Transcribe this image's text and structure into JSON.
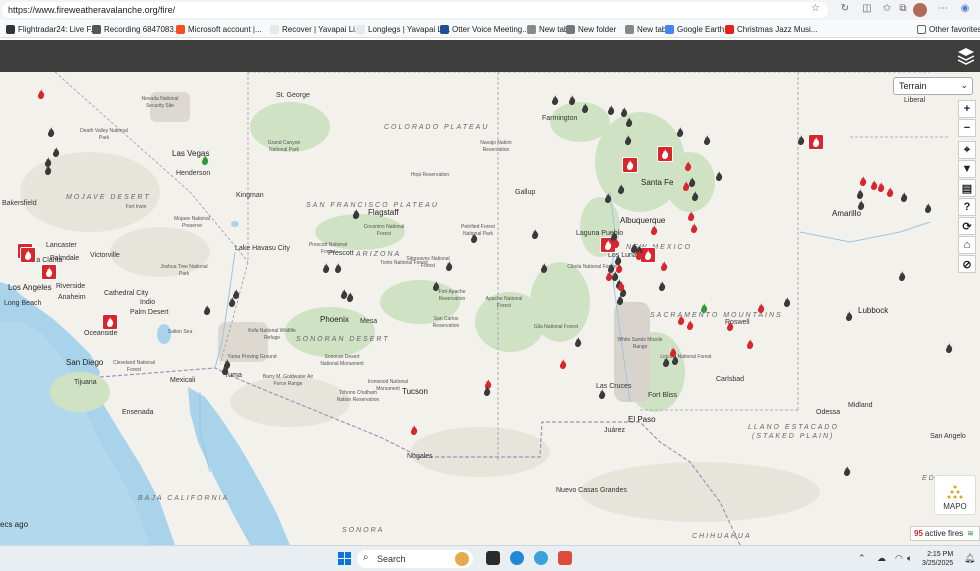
{
  "browser": {
    "url": "https://www.fireweatheravalanche.org/fire/",
    "bookmarks": [
      {
        "label": "Flightradar24: Live F...",
        "color": "#333333"
      },
      {
        "label": "Recording 6847083...",
        "color": "#555555"
      },
      {
        "label": "Microsoft account |...",
        "color": "#f25022"
      },
      {
        "label": "Recover | Yavapai Li...",
        "color": "#e8e8e8"
      },
      {
        "label": "Longlegs | Yavapai Li...",
        "color": "#e8e8e8"
      },
      {
        "label": "Otter Voice Meeting...",
        "color": "#1f4e9a"
      },
      {
        "label": "New tab",
        "color": "#888888"
      },
      {
        "label": "New folder",
        "color": "#777777"
      },
      {
        "label": "New tab",
        "color": "#888888"
      },
      {
        "label": "Google Earth",
        "color": "#4285f4"
      },
      {
        "label": "Christmas Jazz Musi...",
        "color": "#e62117"
      }
    ],
    "other_favorites": "Other favorites"
  },
  "map": {
    "basemap_select": "Terrain",
    "tools": [
      "+",
      "−",
      "⌖",
      "▼",
      "▤",
      "?",
      "⟳",
      "⌂",
      "⊘"
    ],
    "labels": {
      "cities": [
        "Las Vegas",
        "Henderson",
        "Bakersfield",
        "Lancaster",
        "Palmdale",
        "Victorville",
        "Santa Clarita",
        "Los Angeles",
        "Long Beach",
        "Anaheim",
        "Riverside",
        "Oceanside",
        "San Diego",
        "Tijuana",
        "Ensenada",
        "Mexicali",
        "Yuma",
        "Cathedral City",
        "Indio",
        "Palm Desert",
        "Lake Havasu City",
        "Kingman",
        "Flagstaff",
        "Prescott",
        "Phoenix",
        "Mesa",
        "Tucson",
        "Nogales",
        "St. George",
        "Farmington",
        "Gallup",
        "Santa Fe",
        "Albuquerque",
        "Los Lunas",
        "Las Cruces",
        "El Paso",
        "Juárez",
        "Carlsbad",
        "Roswell",
        "Lubbock",
        "Amarillo",
        "Odessa",
        "Midland",
        "San Angelo",
        "Nuevo Casas Grandes",
        "Liberal",
        "Fort Bliss",
        "Laguna Pueblo"
      ],
      "regions": [
        "COLORADO PLATEAU",
        "MOJAVE DESERT",
        "SONORAN DESERT",
        "SAN FRANCISCO PLATEAU",
        "ARIZONA",
        "NEW MEXICO",
        "SACRAMENTO MOUNTAINS",
        "LLANO ESTACADO",
        "(STAKED PLAIN)",
        "SONORA",
        "BAJA CALIFORNIA",
        "CHIHUAHUA",
        "EDWARDS"
      ],
      "reservations": [
        "Grand Canyon National Park",
        "Hopi Reservation",
        "Navajo Nation Reservation",
        "Fort Apache Reservation",
        "San Carlos Reservation",
        "White Sands Missile Range",
        "Barry M. Goldwater Air Force Range",
        "Tohono O'odham Nation Reservation",
        "Petrified Forest National Park",
        "Kofa National Wildlife Refuge",
        "Mojave National Preserve",
        "Death Valley National Park",
        "Nevada National Security Site",
        "Lincoln National Forest",
        "Gila National Forest",
        "Cibola National Forest",
        "Apache National Forest",
        "Tonto National Forest",
        "Coconino National Forest",
        "Prescott National Forest",
        "Sitgreaves National Forest",
        "Ironwood National Monument",
        "Sonoran Desert National Monument",
        "Yuma Proving Ground",
        "Cleveland National Forest",
        "Joshua Tree National Park",
        "Salton Sea",
        "Fort Irwin"
      ]
    },
    "fires": {
      "large_count": 9,
      "small_count": 86
    },
    "updated_text": "ecs ago",
    "brand": "MAPO",
    "active_fires_count": "95",
    "active_fires_label": "active fires"
  },
  "taskbar": {
    "search_placeholder": "Search",
    "time": "2:15 PM",
    "date": "3/25/2025"
  }
}
